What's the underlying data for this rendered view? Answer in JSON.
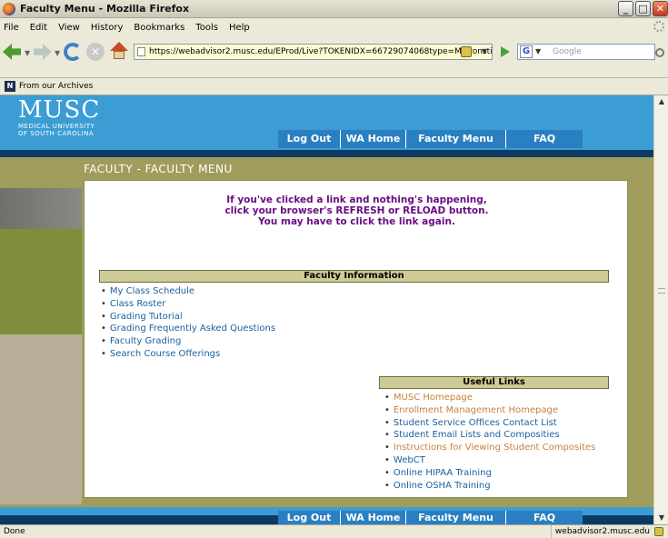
{
  "window": {
    "title": "Faculty Menu - Mozilla Firefox"
  },
  "menu": [
    "File",
    "Edit",
    "View",
    "History",
    "Bookmarks",
    "Tools",
    "Help"
  ],
  "address": {
    "url": "https://webadvisor2.musc.edu/EProd/Live?TOKENIDX=66729074068type=M&constit"
  },
  "search": {
    "placeholder": "Google"
  },
  "bookmarks": {
    "item": "From our Archives"
  },
  "site": {
    "logo_big": "MUSC",
    "logo_small_1": "MEDICAL UNIVERSITY",
    "logo_small_2": "OF SOUTH CAROLINA",
    "nav": [
      "Log Out",
      "WA Home",
      "Faculty Menu",
      "FAQ"
    ]
  },
  "page": {
    "heading": "FACULTY - FACULTY MENU",
    "notice_1": "If you've clicked a link and nothing's happening,",
    "notice_2": "click your browser's REFRESH or RELOAD button.",
    "notice_3": "You may have to click the link again."
  },
  "faculty_info": {
    "title": "Faculty Information",
    "links": [
      "My Class Schedule",
      "Class Roster",
      "Grading Tutorial",
      "Grading Frequently Asked Questions",
      "Faculty Grading",
      "Search Course Offerings"
    ]
  },
  "useful_links": {
    "title": "Useful Links",
    "links": [
      "MUSC Homepage",
      "Enrollment Management Homepage",
      "Student Service Offices Contact List",
      "Student Email Lists and Composities",
      "Instructions for Viewing Student Composites",
      "WebCT",
      "Online HIPAA Training",
      "Online OSHA Training"
    ]
  },
  "status": {
    "text": "Done",
    "host": "webadvisor2.musc.edu"
  },
  "colors": {
    "header_blue": "#3b9dd4",
    "navy": "#0d3a63",
    "olive": "#a09c5c",
    "notice_purple": "#6b0d85",
    "link_blue": "#1a5f9e",
    "visited_orange": "#c8813c"
  }
}
